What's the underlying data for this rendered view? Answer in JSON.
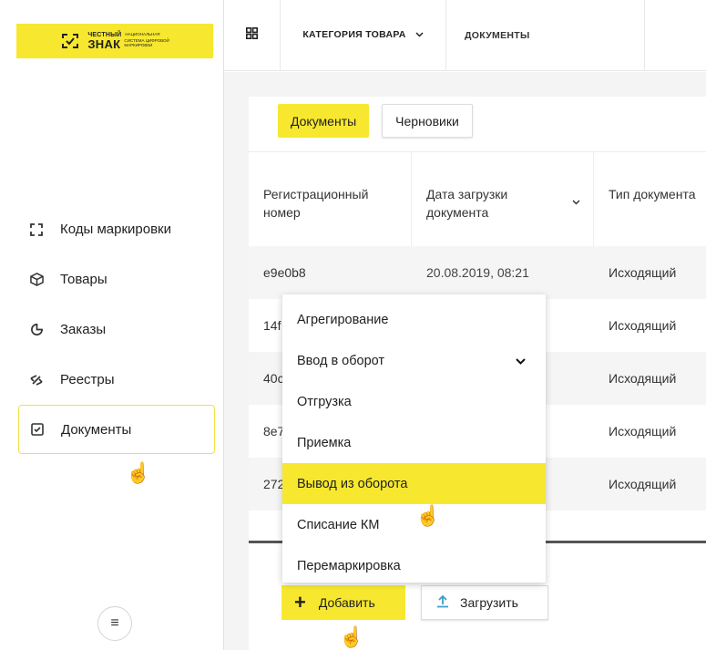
{
  "logo": {
    "top": "ЧЕСТНЫЙ",
    "big": "ЗНАК",
    "sub1": "НАЦИОНАЛЬНАЯ",
    "sub2": "СИСТЕМА ЦИФРОВОЙ",
    "sub3": "МАРКИРОВКИ",
    "color": "#f7e82f"
  },
  "sidebar": {
    "items": [
      {
        "label": "Коды маркировки",
        "icon": "scan-frame-icon"
      },
      {
        "label": "Товары",
        "icon": "box-icon"
      },
      {
        "label": "Заказы",
        "icon": "pie-chart-icon"
      },
      {
        "label": "Реестры",
        "icon": "arrows-icon"
      },
      {
        "label": "Документы",
        "icon": "checkbox-icon",
        "active": true
      }
    ]
  },
  "topbar": {
    "category": "КАТЕГОРИЯ ТОВАРА",
    "documents": "ДОКУМЕНТЫ"
  },
  "tabs": [
    {
      "label": "Документы",
      "active": true
    },
    {
      "label": "Черновики",
      "active": false
    }
  ],
  "table": {
    "headers": [
      "Регистрационный номер",
      "Дата загрузки документа",
      "Тип документа"
    ],
    "rows": [
      {
        "id": "e9e0b8",
        "date": "20.08.2019, 08:21",
        "type": "Исходящий"
      },
      {
        "id": "14f",
        "date": "",
        "type": "Исходящий"
      },
      {
        "id": "40c",
        "date": "",
        "type": "Исходящий"
      },
      {
        "id": "8e7",
        "date": "",
        "type": "Исходящий"
      },
      {
        "id": "272",
        "date": "",
        "type": "Исходящий"
      }
    ]
  },
  "dropdown": {
    "items": [
      {
        "label": "Агрегирование"
      },
      {
        "label": "Ввод в оборот",
        "has_submenu": true
      },
      {
        "label": "Отгрузка"
      },
      {
        "label": "Приемка"
      },
      {
        "label": "Вывод из оборота",
        "highlighted": true
      },
      {
        "label": "Списание КМ"
      },
      {
        "label": "Перемаркировка"
      }
    ]
  },
  "buttons": {
    "add": "Добавить",
    "upload": "Загрузить"
  }
}
